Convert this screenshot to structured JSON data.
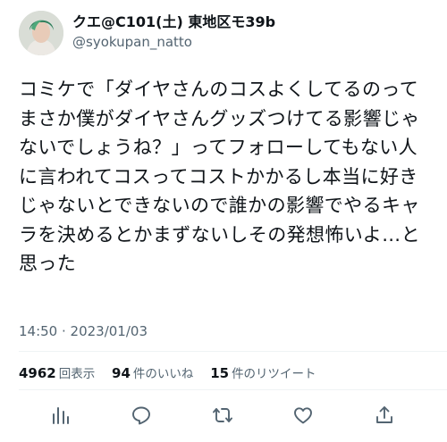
{
  "author": {
    "display_name": "クエ@C101(土) 東地区モ39b",
    "handle": "@syokupan_natto"
  },
  "tweet": {
    "text": "コミケで「ダイヤさんのコスよくしてるのってまさか僕がダイヤさんグッズつけてる影響じゃないでしょうね？」ってフォローしてもない人に言われてコスってコストかかるし本当に好きじゃないとできないので誰かの影響でやるキャラを決めるとかまずないしその発想怖いよ…と思った",
    "timestamp": "14:50 · 2023/01/03"
  },
  "stats": {
    "views_count": "4962",
    "views_label": "回表示",
    "likes_count": "94",
    "likes_label": "件のいいね",
    "retweets_count": "15",
    "retweets_label": "件のリツイート"
  },
  "actions": {
    "icons": [
      "analytics-icon",
      "reply-icon",
      "retweet-icon",
      "like-icon",
      "share-icon"
    ]
  },
  "colors": {
    "text_primary": "#0f1419",
    "text_secondary": "#536471",
    "divider": "#eff3f4"
  }
}
